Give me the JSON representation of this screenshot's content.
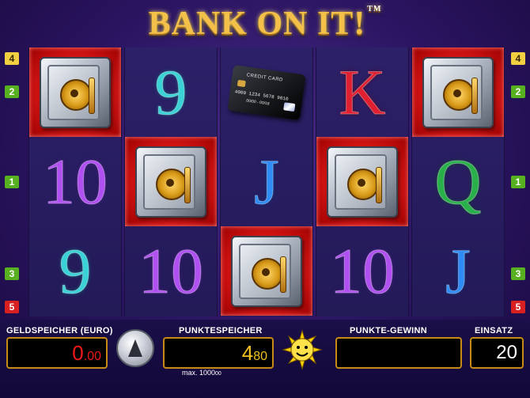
{
  "game": {
    "title": "BANK ON IT!",
    "trademark": "TM"
  },
  "reels": [
    [
      {
        "type": "safe",
        "highlight": true
      },
      {
        "type": "symbol",
        "label": "10",
        "kind": "ten"
      },
      {
        "type": "symbol",
        "label": "9",
        "kind": "nine"
      }
    ],
    [
      {
        "type": "symbol",
        "label": "9",
        "kind": "nine"
      },
      {
        "type": "safe",
        "highlight": true
      },
      {
        "type": "symbol",
        "label": "10",
        "kind": "ten"
      }
    ],
    [
      {
        "type": "card",
        "highlight": false
      },
      {
        "type": "symbol",
        "label": "J",
        "kind": "j"
      },
      {
        "type": "safe",
        "highlight": true
      }
    ],
    [
      {
        "type": "symbol",
        "label": "K",
        "kind": "k"
      },
      {
        "type": "safe",
        "highlight": true
      },
      {
        "type": "symbol",
        "label": "10",
        "kind": "ten"
      }
    ],
    [
      {
        "type": "safe",
        "highlight": true
      },
      {
        "type": "symbol",
        "label": "Q",
        "kind": "q"
      },
      {
        "type": "symbol",
        "label": "J",
        "kind": "j"
      }
    ]
  ],
  "credit_card": {
    "title": "CREDIT CARD",
    "number": "4000 1234 5678 9010",
    "expiry": "00/00 - 00/18"
  },
  "paylines_left": [
    "4",
    "2",
    "1",
    "3",
    "5"
  ],
  "paylines_right": [
    "4",
    "2",
    "1",
    "3",
    "5"
  ],
  "panel": {
    "credit_label": "GELDSPEICHER (EURO)",
    "credit_value": "0.00",
    "points_label": "PUNKTESPEICHER",
    "points_value": "480",
    "points_max": "max. 1000",
    "points_max_small": "00",
    "win_label": "PUNKTE-GEWINN",
    "win_value": "",
    "bet_label": "EINSATZ",
    "bet_value": "20"
  },
  "colors": {
    "credit_red": "#f01818",
    "points_gold": "#f0c020",
    "frame_gold": "#c88a14"
  }
}
